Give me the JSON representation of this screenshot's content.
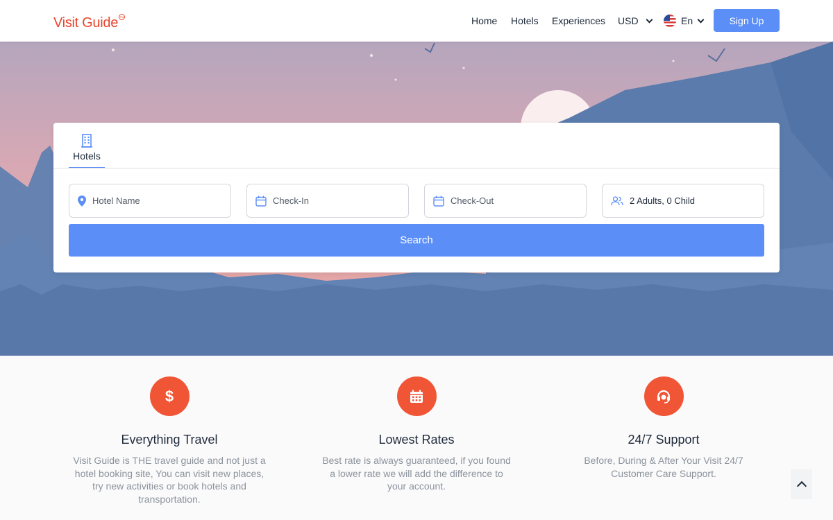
{
  "header": {
    "logo": "Visit Guide",
    "logo_mark": "TM",
    "nav": {
      "home": "Home",
      "hotels": "Hotels",
      "experiences": "Experiences",
      "currency": "USD",
      "language": "En"
    },
    "signup_label": "Sign Up"
  },
  "search": {
    "tab_label": "Hotels",
    "tab_icon": "building-icon",
    "hotel_placeholder": "Hotel Name",
    "checkin_placeholder": "Check-In",
    "checkout_placeholder": "Check-Out",
    "guests_value": "2 Adults, 0 Child",
    "button_label": "Search"
  },
  "features": [
    {
      "icon": "dollar-icon",
      "title": "Everything Travel",
      "description": "Visit Guide is THE travel guide and not just a hotel booking site, You can visit new places, try new activities or book hotels and transportation."
    },
    {
      "icon": "calendar-icon",
      "title": "Lowest Rates",
      "description": "Best rate is always guaranteed, if you found a lower rate we will add the difference to your account."
    },
    {
      "icon": "headset-icon",
      "title": "24/7 Support",
      "description": "Before, During & After Your Visit 24/7 Customer Care Support."
    }
  ],
  "colors": {
    "brand": "#e8452c",
    "primary": "#5b8ef7",
    "feature_icon_bg": "#f05536"
  }
}
